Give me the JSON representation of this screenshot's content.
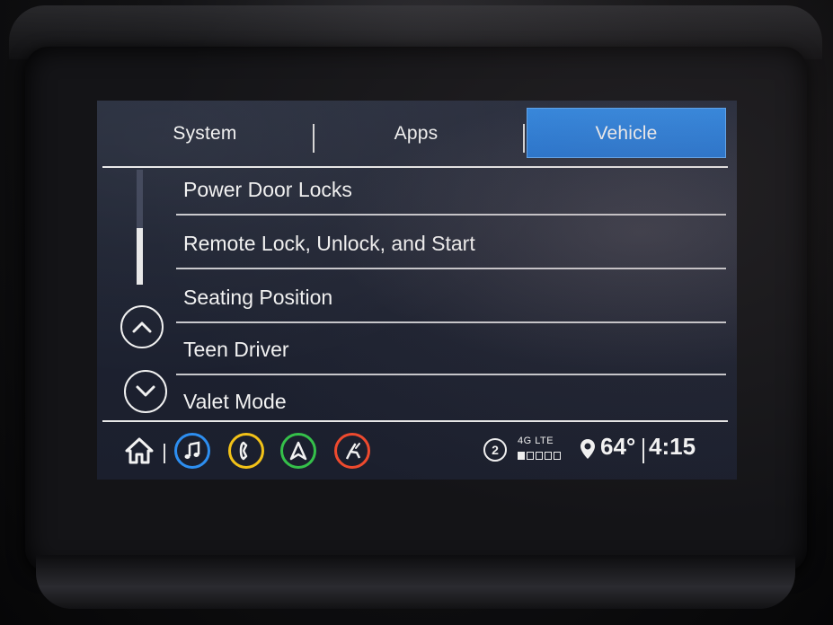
{
  "tabs": [
    {
      "label": "System",
      "active": false
    },
    {
      "label": "Apps",
      "active": false
    },
    {
      "label": "Vehicle",
      "active": true
    }
  ],
  "menu": {
    "items": [
      "Power Door Locks",
      "Remote Lock, Unlock, and Start",
      "Seating Position",
      "Teen Driver",
      "Valet Mode"
    ],
    "scroll_fraction_visible": 0.5
  },
  "status": {
    "notifications": "2",
    "network": "4G LTE",
    "signal_level": 1,
    "signal_max": 5,
    "temperature": "64°",
    "time": "4:15"
  },
  "shortcut_icons": [
    "home-icon",
    "music-note-icon",
    "phone-icon",
    "navigation-arrow-icon",
    "climate-seat-icon"
  ],
  "colors": {
    "active_tab": "#1a6fd0",
    "audio": "#2d8ef0",
    "phone": "#f2c218",
    "nav": "#35c04a",
    "climate": "#ee4a2e"
  }
}
